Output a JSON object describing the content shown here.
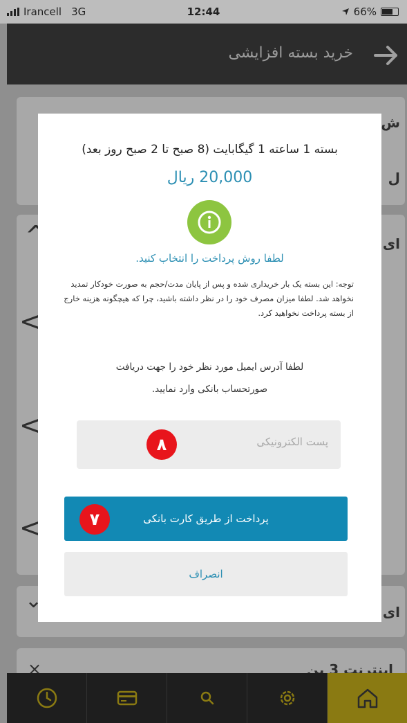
{
  "status_bar": {
    "carrier": "Irancell",
    "network": "3G",
    "time": "12:44",
    "battery": "66%"
  },
  "header": {
    "title": "خرید بسته افزایشی",
    "back_icon": "arrow-right-icon"
  },
  "background": {
    "row1_label": "ش",
    "row2_label": "ل",
    "row3_label": "ای",
    "row4_label": "ای",
    "row5_label": "اینترنت 3 بن"
  },
  "modal": {
    "package_title": "بسته 1 ساعته 1 گیگابایت (8 صبح تا 2 صبح روز بعد)",
    "price": "20,000 ریال",
    "info_icon": "info-icon",
    "select_prompt": "لطفا روش پرداخت را انتخاب کنید.",
    "note": "توجه: این بسته یک بار خریداری شده و پس از پایان مدت/حجم به صورت خودکار تمدید نخواهد شد. لطفا میزان مصرف خود را در نظر داشته باشید، چرا که هیچگونه هزینه خارج از بسته پرداخت نخواهید کرد.",
    "email_prompt_line1": "لطفا آدرس ایمیل مورد نظر خود را جهت دریافت",
    "email_prompt_line2": "صورتحساب بانکی وارد نمایید.",
    "email_value": "",
    "email_placeholder": "پست الکترونیکی",
    "pay_button_label": "پرداخت از طریق کارت بانکی",
    "cancel_button_label": "انصراف"
  },
  "annotations": {
    "email_badge": "۸",
    "pay_badge": "۷"
  },
  "tabbar": {
    "tabs": [
      {
        "icon": "clock-icon"
      },
      {
        "icon": "card-icon"
      },
      {
        "icon": "search-icon"
      },
      {
        "icon": "gear-icon"
      },
      {
        "icon": "home-icon",
        "active": true
      }
    ]
  },
  "colors": {
    "accent": "#1289b4",
    "price": "#2c8fb3",
    "info_icon": "#8dc540",
    "badge": "#e8151c"
  }
}
